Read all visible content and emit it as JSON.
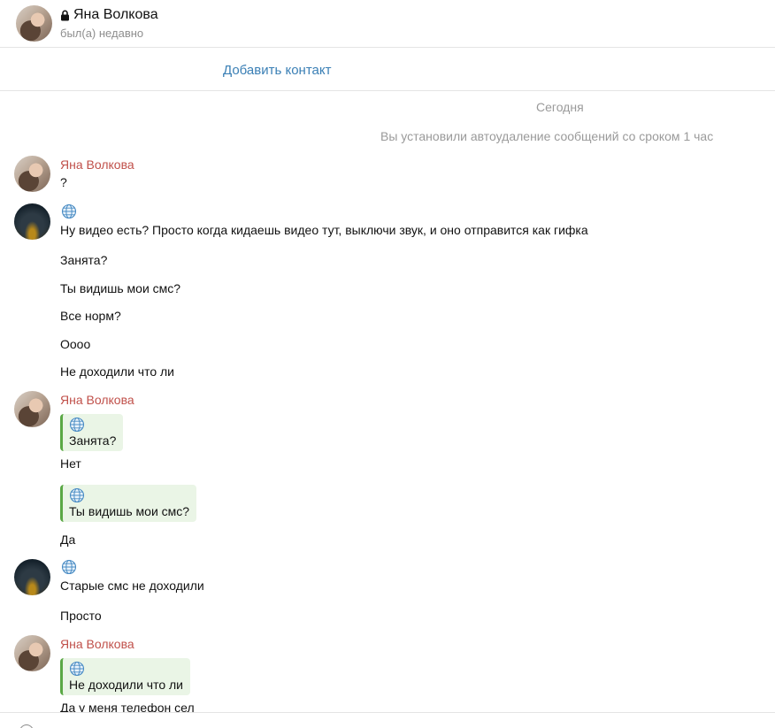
{
  "header": {
    "name": "Яна Волкова",
    "status": "был(а) недавно"
  },
  "add_contact_label": "Добавить контакт",
  "date_separator": "Сегодня",
  "service_message": "Вы установили автоудаление сообщений со сроком 1 час",
  "messages": {
    "g1": {
      "sender": "Яна Волкова",
      "texts": [
        "?"
      ]
    },
    "g2": {
      "texts": [
        "Ну видео есть? Просто когда кидаешь видео тут, выключи звук, и оно отправится как гифка",
        "Занята?",
        "Ты видишь мои смс?",
        "Все норм?",
        "Оооо",
        "Не доходили что ли"
      ]
    },
    "g3": {
      "sender": "Яна Волкова",
      "quote1": "Занята?",
      "reply1": "Нет",
      "quote2": "Ты видишь мои смс?",
      "reply2": "Да"
    },
    "g4": {
      "texts": [
        "Старые смс не доходили",
        "Просто"
      ]
    },
    "g5": {
      "sender": "Яна Волкова",
      "quote1": "Не доходили что ли",
      "reply1": "Да у меня телефон сел"
    }
  },
  "colors": {
    "sender_name": "#c0504a",
    "link": "#3a7fb5",
    "quote_bg": "#eaf5e6",
    "quote_bar": "#5aa845"
  },
  "icons": [
    "lock-icon",
    "globe-icon"
  ]
}
